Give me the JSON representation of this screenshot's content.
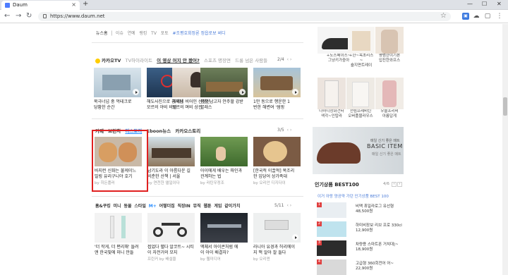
{
  "browser": {
    "tab_title": "Daum",
    "url": "https://www.daum.net",
    "new_tab": "+",
    "close": "×",
    "min": "—",
    "max": "☐",
    "winclose": "✕"
  },
  "news_bar": {
    "label": "뉴스홈",
    "items": [
      "이슈",
      "연예",
      "랭킹",
      "TV",
      "포토"
    ],
    "tag": "#조평호회정론 정읍로보 써디"
  },
  "kakao_tv": {
    "title": "카카오TV",
    "tabs": [
      "TV하이라이트",
      "이 영상 어지 안 봤어?",
      "스포츠 명장면",
      "드롱 넘은 사람들"
    ],
    "pager": "2/4",
    "cards": [
      {
        "caption": "북극너넘 중 먹테크로\n당황한 순간"
      },
      {
        "caption": "해도사진으로 공개된\n모르의 야비 비밀"
      },
      {
        "caption": "해외네 비어인 선정된\n모르의 며비 상관"
      },
      {
        "caption": "평창 남고자 안주할 강받\n굴래스"
      },
      {
        "caption": "1만 동으로 행운한 1\n번한 해변여 '썸핑"
      }
    ]
  },
  "stories": {
    "tabs": [
      "카페",
      "브런치",
      "티스토리",
      "1boon뉴스",
      "카카오스토리"
    ],
    "active": "티스토리",
    "pager": "3/5",
    "cards": [
      {
        "caption": "바지런 신화는 불케이느\n밀링 유리구니야 호기",
        "source": "by 히든플러"
      },
      {
        "caption": "남기도라 이 아름다운 길\n비춘한 산책 | 서울",
        "source": "by 연천한 앨일이다"
      },
      {
        "caption": "아이에게 배우는 파인과\n관계하는 법",
        "source": "by 라틴우정조"
      },
      {
        "caption": "[한국적 이끌적] 목조리\n한 입당어 상가족대",
        "source": "by 오리안 디지다이"
      }
    ]
  },
  "shopping": {
    "tabs": [
      "홈&쿠킹",
      "미니",
      "동물",
      "스타일",
      "M+",
      "어떻더집",
      "직장IN",
      "뮤직",
      "웹툰",
      "게임",
      "같이가치"
    ],
    "pager": "5/11",
    "cards": [
      {
        "caption": "'더 작게, 더 편리해' 들려\n앤 한국빛에 미니 만들"
      },
      {
        "caption": "접었다 펼다 알코트~ 시티\n이 자전거의 모지",
        "source": "프린커 by 배설을"
      },
      {
        "caption": "액체서 아이콘처럼 에\n이 아이 배결자?",
        "source": "by 웹미디어"
      },
      {
        "caption": "라니아 유경과 허리에이\n지 맥 알아 잘 들다",
        "source": "by 오리엔"
      },
      {
        "caption": ""
      }
    ]
  },
  "right_products": {
    "row1": [
      "+노스페이스~\n그냥키가중아",
      "+한~목초리스~\n숄지면트레이",
      "평범한이기본\n입진한와프스"
    ],
    "row2": [
      "나마니상화건터\n색각~인탑라",
      "천림프레비틴\n오버플블라우스",
      "우물프리비\n아름답게"
    ]
  },
  "banner": {
    "line1": "매일 신기 좋은 매트",
    "line2": "BASIC ITEM",
    "line3": "매일 신기 좋은 매트"
  },
  "best": {
    "title": "인기상품 BEST100",
    "pager": "4/6",
    "subtitle": "이거 아랑 양공약 가던 인기상품 BEST 100",
    "items": [
      {
        "rank": "1",
        "text": "비맥 휴일라로그 유선형\n48,500원"
      },
      {
        "rank": "2",
        "text": "하미비장보 리브 프로 330cl\n12,900원"
      },
      {
        "rank": "3",
        "text": "차량용 스마트폰 거치대|~\n18,900원"
      },
      {
        "rank": "4",
        "text": "고급형 360회전어 어~\n22,900원"
      }
    ]
  },
  "colors": {
    "accent": "#2b8fff",
    "highlight": "#e02020"
  }
}
